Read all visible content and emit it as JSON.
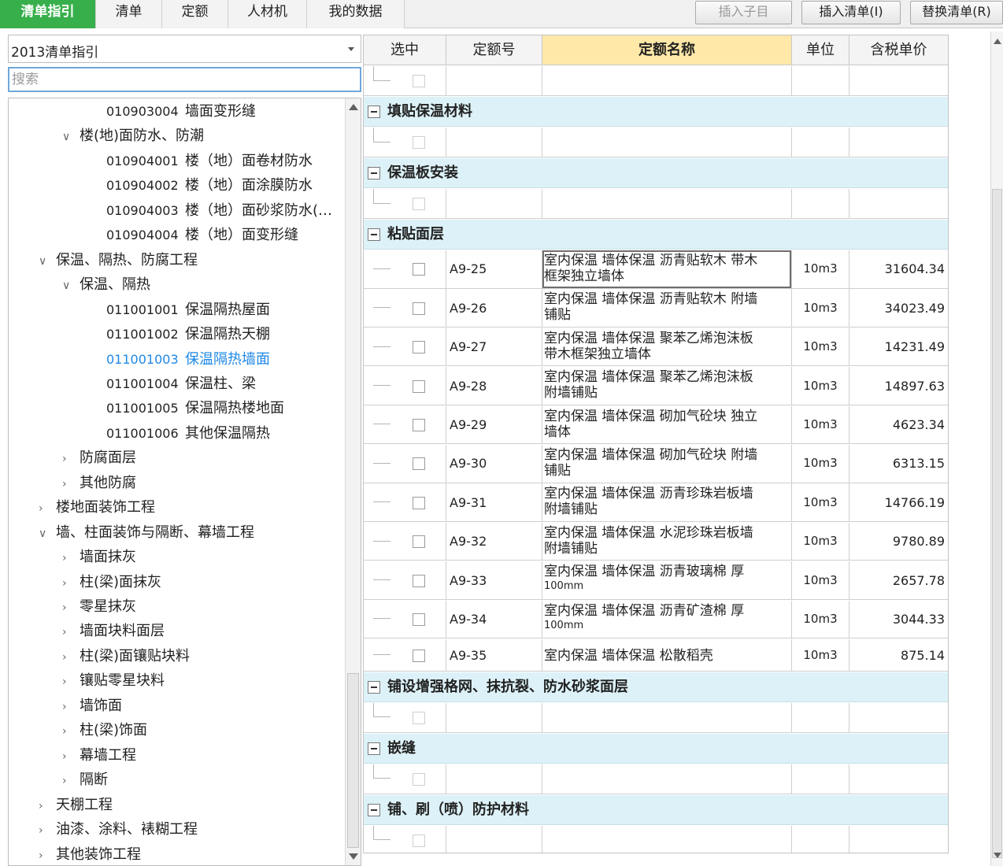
{
  "tabs": [
    {
      "label": "清单指引",
      "active": true
    },
    {
      "label": "清单",
      "active": false
    },
    {
      "label": "定额",
      "active": false
    },
    {
      "label": "人材机",
      "active": false
    },
    {
      "label": "我的数据",
      "active": false
    }
  ],
  "toolbar": {
    "insert_child": "插入子目",
    "insert_list": "插入清单(I)",
    "replace_list": "替换清单(R)"
  },
  "left": {
    "combo_value": "2013清单指引",
    "search_placeholder": "搜索",
    "tree": [
      {
        "level": 3,
        "code": "010903004",
        "label": "墙面变形缝",
        "chevron": ""
      },
      {
        "level": 2,
        "code": "",
        "label": "楼(地)面防水、防潮",
        "chevron": "expanded"
      },
      {
        "level": 3,
        "code": "010904001",
        "label": "楼（地）面卷材防水",
        "chevron": ""
      },
      {
        "level": 3,
        "code": "010904002",
        "label": "楼（地）面涂膜防水",
        "chevron": ""
      },
      {
        "level": 3,
        "code": "010904003",
        "label": "楼（地）面砂浆防水(…",
        "chevron": ""
      },
      {
        "level": 3,
        "code": "010904004",
        "label": "楼（地）面变形缝",
        "chevron": ""
      },
      {
        "level": 1,
        "code": "",
        "label": "保温、隔热、防腐工程",
        "chevron": "expanded"
      },
      {
        "level": 2,
        "code": "",
        "label": "保温、隔热",
        "chevron": "expanded"
      },
      {
        "level": 3,
        "code": "011001001",
        "label": "保温隔热屋面",
        "chevron": ""
      },
      {
        "level": 3,
        "code": "011001002",
        "label": "保温隔热天棚",
        "chevron": ""
      },
      {
        "level": 3,
        "code": "011001003",
        "label": "保温隔热墙面",
        "chevron": "",
        "selected": true
      },
      {
        "level": 3,
        "code": "011001004",
        "label": "保温柱、梁",
        "chevron": ""
      },
      {
        "level": 3,
        "code": "011001005",
        "label": "保温隔热楼地面",
        "chevron": ""
      },
      {
        "level": 3,
        "code": "011001006",
        "label": "其他保温隔热",
        "chevron": ""
      },
      {
        "level": 2,
        "code": "",
        "label": "防腐面层",
        "chevron": "collapsed"
      },
      {
        "level": 2,
        "code": "",
        "label": "其他防腐",
        "chevron": "collapsed"
      },
      {
        "level": 1,
        "code": "",
        "label": "楼地面装饰工程",
        "chevron": "collapsed"
      },
      {
        "level": 1,
        "code": "",
        "label": "墙、柱面装饰与隔断、幕墙工程",
        "chevron": "expanded"
      },
      {
        "level": 2,
        "code": "",
        "label": "墙面抹灰",
        "chevron": "collapsed"
      },
      {
        "level": 2,
        "code": "",
        "label": "柱(梁)面抹灰",
        "chevron": "collapsed"
      },
      {
        "level": 2,
        "code": "",
        "label": "零星抹灰",
        "chevron": "collapsed"
      },
      {
        "level": 2,
        "code": "",
        "label": "墙面块料面层",
        "chevron": "collapsed"
      },
      {
        "level": 2,
        "code": "",
        "label": "柱(梁)面镶贴块料",
        "chevron": "collapsed"
      },
      {
        "level": 2,
        "code": "",
        "label": "镶贴零星块料",
        "chevron": "collapsed"
      },
      {
        "level": 2,
        "code": "",
        "label": "墙饰面",
        "chevron": "collapsed"
      },
      {
        "level": 2,
        "code": "",
        "label": "柱(梁)饰面",
        "chevron": "collapsed"
      },
      {
        "level": 2,
        "code": "",
        "label": "幕墙工程",
        "chevron": "collapsed"
      },
      {
        "level": 2,
        "code": "",
        "label": "隔断",
        "chevron": "collapsed"
      },
      {
        "level": 1,
        "code": "",
        "label": "天棚工程",
        "chevron": "collapsed"
      },
      {
        "level": 1,
        "code": "",
        "label": "油漆、涂料、裱糊工程",
        "chevron": "collapsed"
      },
      {
        "level": 1,
        "code": "",
        "label": "其他装饰工程",
        "chevron": "collapsed"
      }
    ]
  },
  "grid": {
    "headers": [
      "选中",
      "定额号",
      "定额名称",
      "单位",
      "含税单价"
    ],
    "rows": [
      {
        "type": "empty"
      },
      {
        "type": "group",
        "title": "填贴保温材料"
      },
      {
        "type": "empty"
      },
      {
        "type": "group",
        "title": "保温板安装"
      },
      {
        "type": "empty"
      },
      {
        "type": "group",
        "title": "粘贴面层"
      },
      {
        "type": "item",
        "code": "A9-25",
        "name": [
          "室内保温 墙体保温 沥青贴软木 带木",
          "框架独立墙体"
        ],
        "unit": "10m3",
        "price": "31604.34",
        "focused": true
      },
      {
        "type": "item",
        "code": "A9-26",
        "name": [
          "室内保温 墙体保温 沥青贴软木 附墙",
          "铺贴"
        ],
        "unit": "10m3",
        "price": "34023.49"
      },
      {
        "type": "item",
        "code": "A9-27",
        "name": [
          "室内保温 墙体保温 聚苯乙烯泡沫板",
          "带木框架独立墙体"
        ],
        "unit": "10m3",
        "price": "14231.49"
      },
      {
        "type": "item",
        "code": "A9-28",
        "name": [
          "室内保温 墙体保温 聚苯乙烯泡沫板",
          "附墙铺贴"
        ],
        "unit": "10m3",
        "price": "14897.63"
      },
      {
        "type": "item",
        "code": "A9-29",
        "name": [
          "室内保温 墙体保温 砌加气砼块 独立",
          "墙体"
        ],
        "unit": "10m3",
        "price": "4623.34"
      },
      {
        "type": "item",
        "code": "A9-30",
        "name": [
          "室内保温 墙体保温 砌加气砼块 附墙",
          "铺贴"
        ],
        "unit": "10m3",
        "price": "6313.15"
      },
      {
        "type": "item",
        "code": "A9-31",
        "name": [
          "室内保温 墙体保温 沥青珍珠岩板墙",
          "附墙铺贴"
        ],
        "unit": "10m3",
        "price": "14766.19"
      },
      {
        "type": "item",
        "code": "A9-32",
        "name": [
          "室内保温 墙体保温 水泥珍珠岩板墙",
          "附墙铺贴"
        ],
        "unit": "10m3",
        "price": "9780.89"
      },
      {
        "type": "item",
        "code": "A9-33",
        "name": [
          "室内保温 墙体保温 沥青玻璃棉 厚",
          "100mm"
        ],
        "unit": "10m3",
        "price": "2657.78"
      },
      {
        "type": "item",
        "code": "A9-34",
        "name": [
          "室内保温 墙体保温 沥青矿渣棉 厚",
          "100mm"
        ],
        "unit": "10m3",
        "price": "3044.33"
      },
      {
        "type": "item",
        "code": "A9-35",
        "name": [
          "室内保温 墙体保温 松散稻壳"
        ],
        "unit": "10m3",
        "price": "875.14",
        "last": true
      },
      {
        "type": "group",
        "title": "铺设增强格网、抹抗裂、防水砂浆面层"
      },
      {
        "type": "empty"
      },
      {
        "type": "group",
        "title": "嵌缝"
      },
      {
        "type": "empty"
      },
      {
        "type": "group",
        "title": "铺、刷（喷）防护材料"
      },
      {
        "type": "empty"
      }
    ]
  },
  "colors": {
    "accent": "#37b04b",
    "selected_text": "#1e88e5",
    "group_bg": "#ddf2f8",
    "active_header": "#ffe8a8"
  }
}
